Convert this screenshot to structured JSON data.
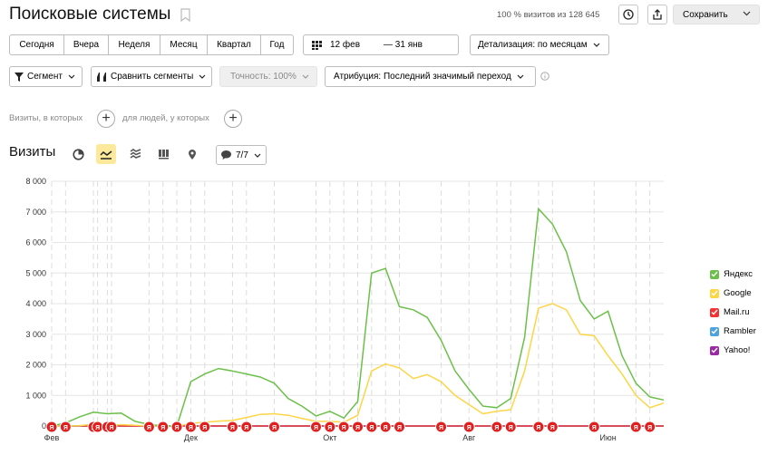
{
  "header": {
    "title": "Поисковые системы",
    "visits_info": "100 % визитов из 128 645",
    "save_label": "Сохранить"
  },
  "periods": [
    "Сегодня",
    "Вчера",
    "Неделя",
    "Месяц",
    "Квартал",
    "Год"
  ],
  "date_range": {
    "from": "12 фев",
    "to": "— 31 янв"
  },
  "detail_label": "Детализация: по месяцам",
  "toolbar": {
    "segment": "Сегмент",
    "compare": "Сравнить сегменты",
    "accuracy": "Точность: 100%",
    "attribution": "Атрибуция: Последний значимый переход"
  },
  "conditions": {
    "visits_which": "Визиты, в которых",
    "for_people": "для людей, у которых"
  },
  "section": {
    "title": "Визиты",
    "comments_count": "7/7"
  },
  "icons": [
    "bookmark-icon",
    "history-icon",
    "share-icon",
    "calendar-icon",
    "filter-icon",
    "compare-icon",
    "info-icon",
    "pie-icon",
    "line-chart-icon",
    "area-chart-icon",
    "bar-chart-icon",
    "map-icon",
    "comment-icon"
  ],
  "chart_data": {
    "type": "line",
    "ylim": [
      0,
      8000
    ],
    "y_ticks": [
      "0",
      "1 000",
      "2 000",
      "3 000",
      "4 000",
      "5 000",
      "6 000",
      "7 000",
      "8 000"
    ],
    "x_tick_labels": [
      {
        "label": "Фев",
        "i": 0
      },
      {
        "label": "Дек",
        "i": 10
      },
      {
        "label": "Окт",
        "i": 20
      },
      {
        "label": "Авг",
        "i": 30
      },
      {
        "label": "Июн",
        "i": 40
      }
    ],
    "series": [
      {
        "name": "Яндекс",
        "color": "#6cc04a",
        "values": [
          0,
          100,
          300,
          450,
          400,
          420,
          150,
          50,
          0,
          0,
          1450,
          1700,
          1880,
          1800,
          1700,
          1600,
          1400,
          900,
          650,
          330,
          480,
          260,
          800,
          5000,
          5150,
          3900,
          3800,
          3550,
          2800,
          1800,
          1200,
          650,
          600,
          900,
          2900,
          7100,
          6600,
          5700,
          4100,
          3500,
          3750,
          2300,
          1400,
          950,
          850
        ]
      },
      {
        "name": "Google",
        "color": "#fdd545",
        "values": [
          0,
          0,
          10,
          60,
          40,
          40,
          20,
          0,
          0,
          0,
          80,
          120,
          160,
          180,
          280,
          380,
          400,
          350,
          250,
          150,
          150,
          120,
          350,
          1800,
          2030,
          1900,
          1550,
          1680,
          1450,
          1000,
          700,
          400,
          480,
          530,
          1800,
          3850,
          4000,
          3800,
          3000,
          2950,
          2300,
          1700,
          1000,
          600,
          750
        ]
      },
      {
        "name": "Mail.ru",
        "color": "#f23333",
        "values": [
          0,
          0,
          0,
          0,
          0,
          0,
          0,
          0,
          0,
          0,
          0,
          0,
          0,
          0,
          0,
          0,
          0,
          0,
          0,
          0,
          0,
          0,
          0,
          0,
          0,
          0,
          0,
          0,
          0,
          0,
          0,
          0,
          0,
          0,
          0,
          0,
          0,
          0,
          0,
          0,
          0,
          0,
          0,
          0,
          0
        ]
      },
      {
        "name": "Rambler",
        "color": "#4ba3e0",
        "values": [
          0,
          0,
          0,
          0,
          0,
          0,
          0,
          0,
          0,
          0,
          0,
          0,
          0,
          0,
          0,
          0,
          0,
          0,
          0,
          0,
          0,
          0,
          0,
          0,
          0,
          0,
          0,
          0,
          0,
          0,
          0,
          0,
          0,
          0,
          0,
          0,
          0,
          0,
          0,
          0,
          0,
          0,
          0,
          0,
          0
        ]
      },
      {
        "name": "Yahoo!",
        "color": "#9b2aa5",
        "values": [
          0,
          0,
          0,
          0,
          0,
          0,
          0,
          0,
          0,
          0,
          0,
          0,
          0,
          0,
          0,
          0,
          0,
          0,
          0,
          0,
          0,
          0,
          0,
          0,
          0,
          0,
          0,
          0,
          0,
          0,
          0,
          0,
          0,
          0,
          0,
          0,
          0,
          0,
          0,
          0,
          0,
          0,
          0,
          0,
          0
        ]
      }
    ],
    "marker_label": "Я",
    "marker_indices": [
      0,
      1,
      3,
      3.3,
      4,
      4.3,
      7,
      8,
      9,
      10,
      11,
      13,
      14,
      16,
      19,
      20,
      21,
      22,
      23,
      24,
      25,
      28,
      30,
      32,
      33,
      35,
      36,
      39,
      42,
      43
    ],
    "legend_placement": "right",
    "grid": true
  }
}
